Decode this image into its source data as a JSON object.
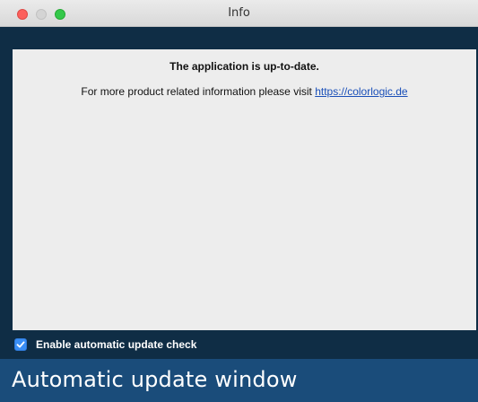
{
  "window": {
    "title": "Info"
  },
  "content": {
    "headline": "The application is up-to-date.",
    "info_text": "For more product related information please visit ",
    "link_text": "https://colorlogic.de"
  },
  "footer": {
    "checkbox_label": "Enable automatic update check",
    "checkbox_checked": true
  },
  "caption": {
    "text": "Automatic update window"
  },
  "colors": {
    "frame": "#0f2d45",
    "caption_bg": "#1a4c7a",
    "link": "#1a4fb8",
    "checkbox": "#3a8ef5"
  },
  "icons": {
    "close": "close-traffic-light-icon",
    "minimize": "minimize-traffic-light-icon",
    "maximize": "maximize-traffic-light-icon",
    "checkmark": "checkmark-icon"
  }
}
